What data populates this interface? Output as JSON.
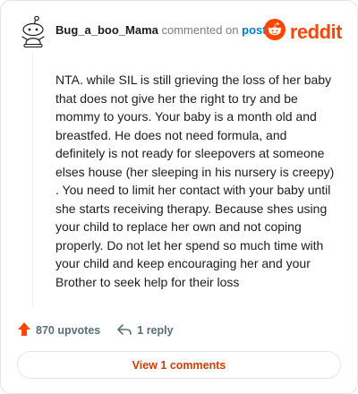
{
  "comment": {
    "username": "Bug_a_boo_Mama",
    "action_text": "commented on",
    "post_link": "post",
    "body": "NTA. while SIL is still grieving the loss of her baby that does not give her the right to try and be mommy to yours. Your baby is a month old and breastfed. He does not need formula, and definitely is not ready for sleepovers at someone elses house (her sleeping in his nursery is creepy) . You need to limit her contact with your baby until she starts receiving therapy. Because shes using your child to replace her own and not coping properly. Do not let her spend so much time with your child and keep encouraging her and your Brother to seek help for their loss",
    "avatar_icon": "snoo-avatar-icon"
  },
  "brand": {
    "wordmark": "reddit",
    "icon": "reddit-logo-icon",
    "color": "#ff4500"
  },
  "actions": {
    "upvotes": "870 upvotes",
    "upvote_icon": "upvote-arrow-icon",
    "upvote_color": "#ff4500",
    "reply": "1 reply",
    "reply_icon": "reply-arrow-icon"
  },
  "footer": {
    "view_comments": "View 1 comments",
    "accent_color": "#d93a00"
  }
}
